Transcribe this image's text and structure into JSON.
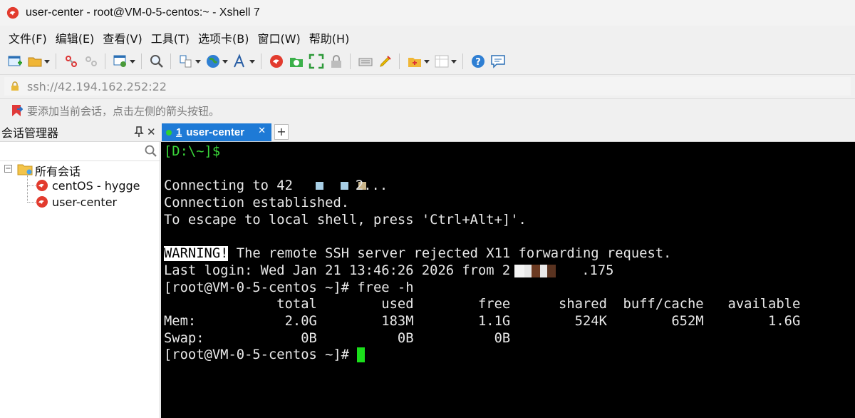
{
  "window": {
    "title": "user-center - root@VM-0-5-centos:~ - Xshell 7"
  },
  "menu": [
    "文件(F)",
    "编辑(E)",
    "查看(V)",
    "工具(T)",
    "选项卡(B)",
    "窗口(W)",
    "帮助(H)"
  ],
  "toolbar": {
    "icons": [
      "new-session-icon",
      "open-folder-icon",
      "connect-icon",
      "disconnect-icon",
      "properties-icon",
      "find-icon",
      "transfer-icon",
      "globe-icon",
      "font-icon",
      "xshell-icon",
      "xftp-icon",
      "fullscreen-icon",
      "lock-icon",
      "keyboard-icon",
      "highlight-icon",
      "folder-add-icon",
      "layout-icon",
      "help-icon",
      "chat-icon"
    ]
  },
  "address": {
    "value": "ssh://42.194.162.252:22"
  },
  "hint": {
    "text": "要添加当前会话，点击左侧的箭头按钮。"
  },
  "session_manager": {
    "title": "会话管理器",
    "root_label": "所有会话",
    "sessions": [
      "centOS - hygge",
      "user-center"
    ]
  },
  "tabs": [
    {
      "number": "1",
      "label": "user-center"
    }
  ],
  "terminal": {
    "prompt_local": "[D:\\~]$",
    "connecting_prefix": "Connecting to 42",
    "connecting_suffix": "2...",
    "established": "Connection established.",
    "escape_hint": "To escape to local shell, press 'Ctrl+Alt+]'.",
    "warning_label": "WARNING!",
    "warning_text": " The remote SSH server rejected X11 forwarding request.",
    "last_login_prefix": "Last login: Wed Jan 21 13:46:26 2026 from 2",
    "last_login_suffix": ".175",
    "command_line": "[root@VM-0-5-centos ~]# free -h",
    "free_header": "              total        used        free      shared  buff/cache   available",
    "free_mem": "Mem:           2.0G        183M        1.1G        524K        652M        1.6G",
    "free_swap": "Swap:            0B          0B          0B",
    "prompt_end": "[root@VM-0-5-centos ~]# "
  }
}
